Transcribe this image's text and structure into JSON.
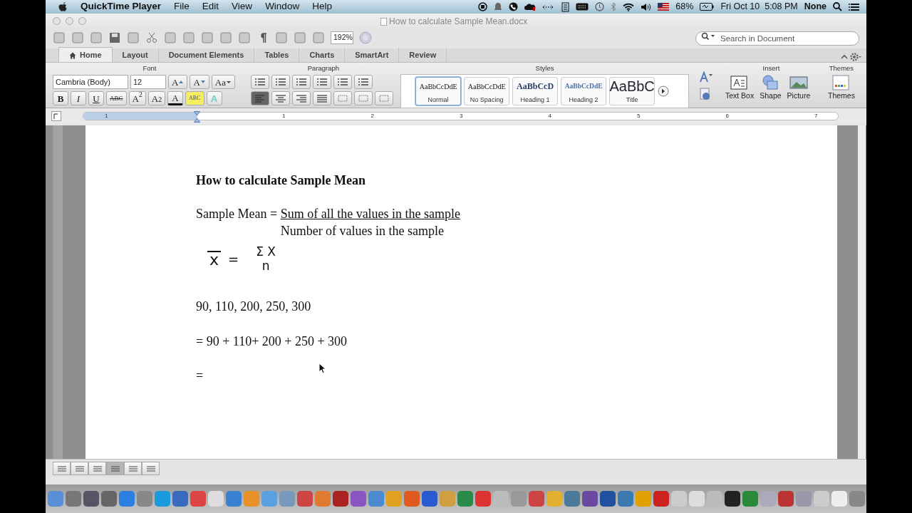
{
  "menubar": {
    "app": "QuickTime Player",
    "menus": [
      "File",
      "Edit",
      "View",
      "Window",
      "Help"
    ],
    "battery": "68%",
    "clock": "Fri Oct 10  5:08 PM",
    "user": "None"
  },
  "window": {
    "title": "How to calculate Sample Mean.docx"
  },
  "toolbar": {
    "zoom": "192%",
    "search": {
      "placeholder": "Search in Document"
    }
  },
  "ribbon_tabs": [
    {
      "label": "Home",
      "selected": true
    },
    {
      "label": "Layout",
      "selected": false
    },
    {
      "label": "Document Elements",
      "selected": false
    },
    {
      "label": "Tables",
      "selected": false
    },
    {
      "label": "Charts",
      "selected": false
    },
    {
      "label": "SmartArt",
      "selected": false
    },
    {
      "label": "Review",
      "selected": false
    }
  ],
  "font_group": {
    "title": "Font",
    "font": "Cambria (Body)",
    "size": "12",
    "size_buttons": [
      {
        "label": "A",
        "kind": "grow"
      },
      {
        "label": "A",
        "kind": "shrink"
      },
      {
        "label": "Aa",
        "kind": "case"
      }
    ],
    "format_buttons": [
      {
        "label": "B",
        "kind": "bold"
      },
      {
        "label": "I",
        "kind": "italic"
      },
      {
        "label": "U",
        "kind": "underline"
      },
      {
        "label": "ABC",
        "kind": "strike"
      },
      {
        "label": "A$^{2}$",
        "kind": "sup"
      },
      {
        "label": "A$_{2}$",
        "kind": "sub"
      }
    ],
    "color_buttons": [
      {
        "label": "A",
        "kind": "font-color"
      },
      {
        "label": "ABC",
        "kind": "highlight"
      },
      {
        "label": "A",
        "kind": "effects"
      }
    ]
  },
  "paragraph_group": {
    "title": "Paragraph",
    "alignment": [
      {
        "kind": "left",
        "selected": true
      },
      {
        "kind": "center",
        "selected": false
      },
      {
        "kind": "right",
        "selected": false
      },
      {
        "kind": "justify",
        "selected": false
      }
    ]
  },
  "styles_group": {
    "title": "Styles",
    "styles": [
      {
        "sample": "AaBbCcDdE",
        "name": "Normal",
        "kind": "normal",
        "selected": true
      },
      {
        "sample": "AaBbCcDdE",
        "name": "No Spacing",
        "kind": "normal",
        "selected": false
      },
      {
        "sample": "AaBbCcD",
        "name": "Heading 1",
        "kind": "heading1",
        "selected": false
      },
      {
        "sample": "AaBbCcDdE",
        "name": "Heading 2",
        "kind": "heading2",
        "selected": false
      },
      {
        "sample": "AaBbC",
        "name": "Title",
        "kind": "title",
        "selected": false
      }
    ]
  },
  "insert_group": {
    "title": "Insert",
    "items": [
      {
        "label": "Text Box",
        "kind": "textbox"
      },
      {
        "label": "Shape",
        "kind": "shape"
      },
      {
        "label": "Picture",
        "kind": "picture"
      }
    ]
  },
  "themes_group": {
    "title": "Themes",
    "label": "Themes"
  },
  "ruler": {
    "labels": [
      "1",
      "1",
      "2",
      "3",
      "4",
      "5",
      "6",
      "7"
    ]
  },
  "document": {
    "title": "How to calculate Sample Mean",
    "definition": {
      "lead": "Sample Mean = ",
      "numerator": "Sum of all the values in the sample",
      "denominator": "Number of values in the sample"
    },
    "formula": {
      "symbol": "x",
      "equals": "=",
      "numerator": "Σ X",
      "denominator": "n"
    },
    "lines": [
      "90, 110, 200, 250, 300",
      "= 90 + 110+ 200 + 250 + 300",
      "="
    ]
  },
  "view_buttons": [
    {
      "selected": false
    },
    {
      "selected": false
    },
    {
      "selected": false
    },
    {
      "selected": true
    },
    {
      "selected": false
    },
    {
      "selected": false
    }
  ]
}
